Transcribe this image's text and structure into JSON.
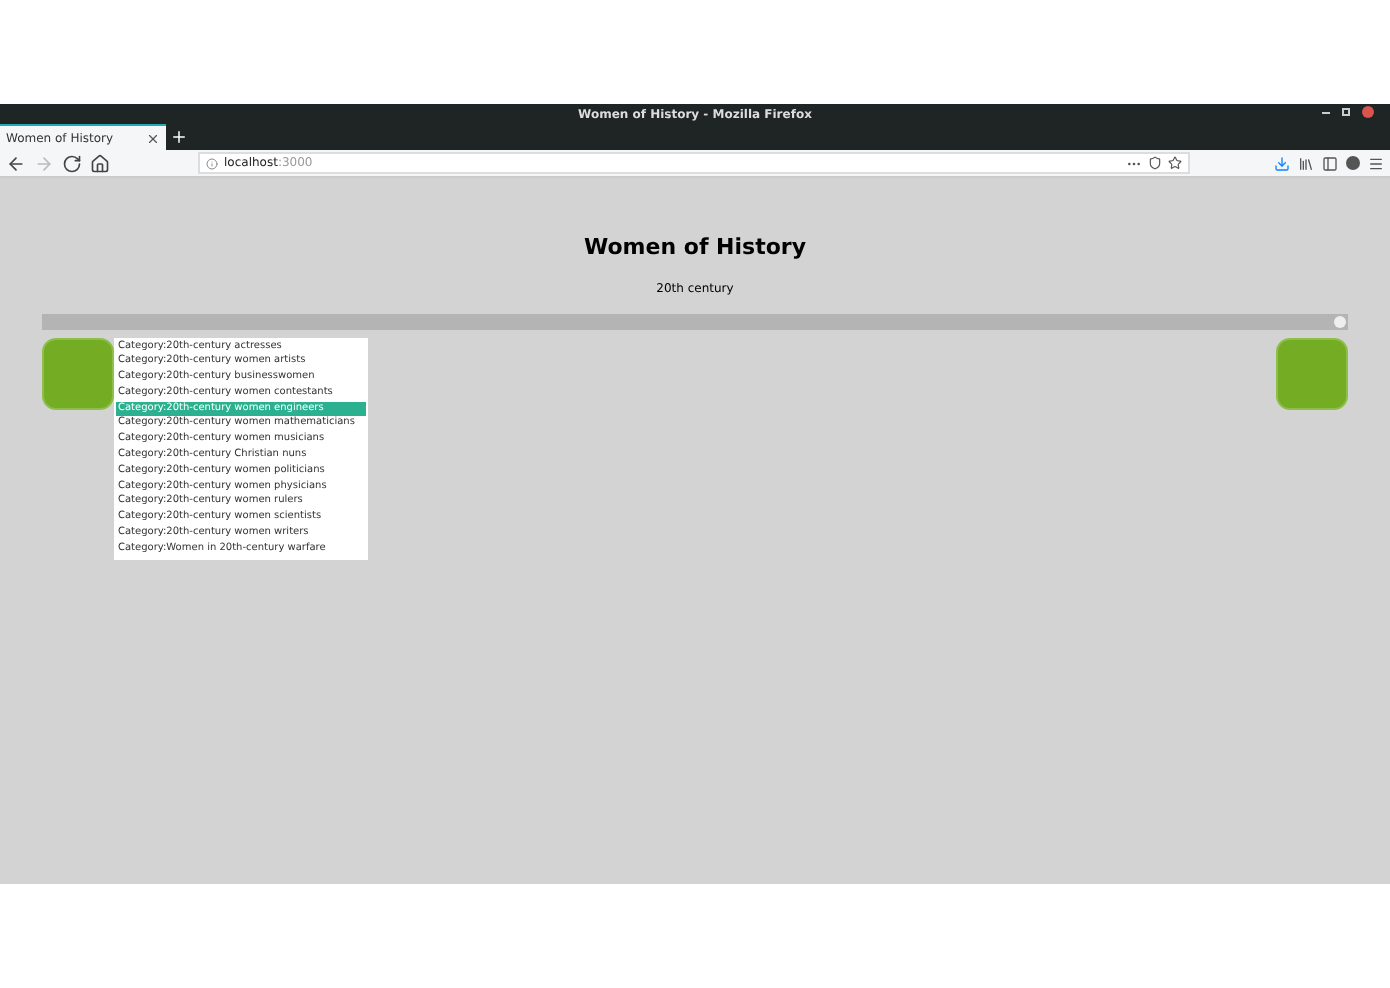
{
  "window": {
    "title": "Women of History - Mozilla Firefox"
  },
  "tabs": [
    {
      "label": "Women of History",
      "selected": true
    }
  ],
  "address_bar": {
    "host": "localhost",
    "port": ":3000"
  },
  "page": {
    "title": "Women of History",
    "subtitle": "20th century",
    "slider": {
      "level": 1
    },
    "categories": [
      {
        "label": "Category:20th-century actresses",
        "selected": false
      },
      {
        "label": "Category:20th-century women artists",
        "selected": false
      },
      {
        "label": "Category:20th-century businesswomen",
        "selected": false
      },
      {
        "label": "Category:20th-century women contestants",
        "selected": false
      },
      {
        "label": "Category:20th-century women engineers",
        "selected": true
      },
      {
        "label": "Category:20th-century women mathematicians",
        "selected": false
      },
      {
        "label": "Category:20th-century women musicians",
        "selected": false
      },
      {
        "label": "Category:20th-century Christian nuns",
        "selected": false
      },
      {
        "label": "Category:20th-century women politicians",
        "selected": false
      },
      {
        "label": "Category:20th-century women physicians",
        "selected": false
      },
      {
        "label": "Category:20th-century women rulers",
        "selected": false
      },
      {
        "label": "Category:20th-century women scientists",
        "selected": false
      },
      {
        "label": "Category:20th-century women writers",
        "selected": false
      },
      {
        "label": "Category:Women in 20th-century warfare",
        "selected": false
      }
    ]
  }
}
